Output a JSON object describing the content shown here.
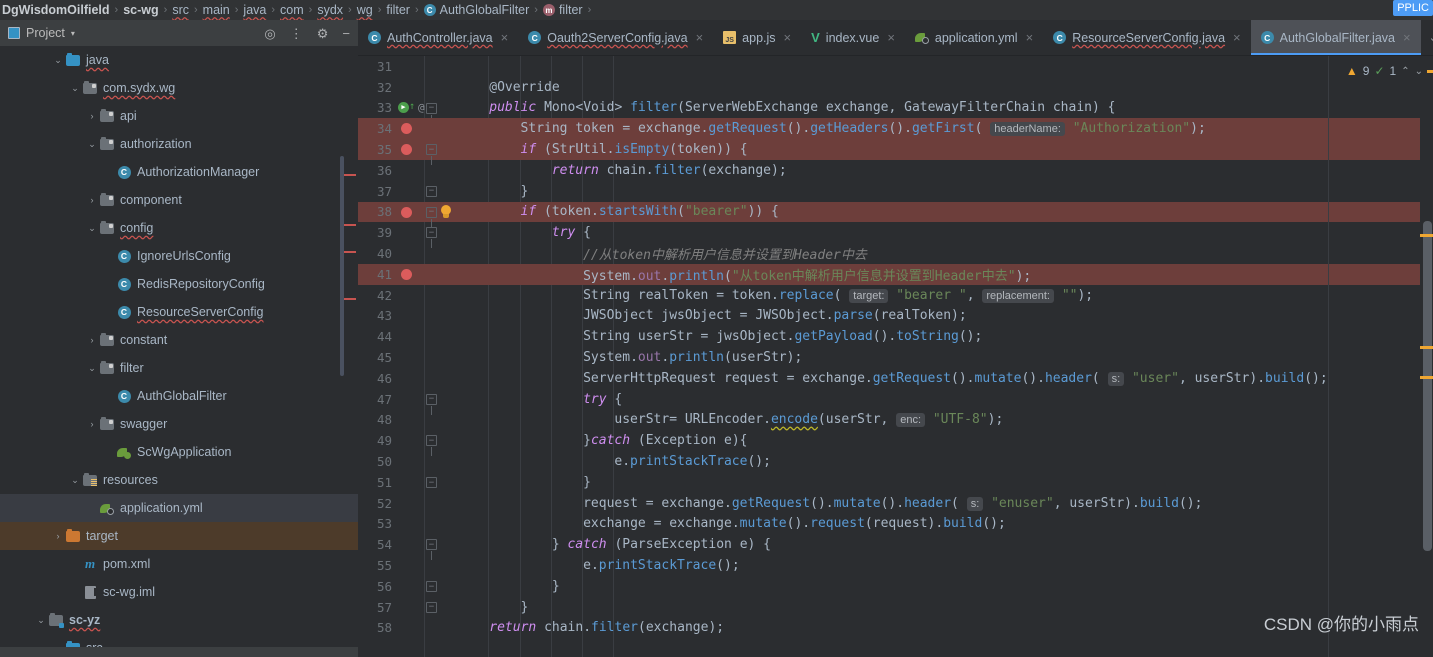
{
  "breadcrumb": {
    "items": [
      {
        "label": "DgWisdomOilfield",
        "style": "bold",
        "icon": ""
      },
      {
        "label": "sc-wg",
        "style": "bold",
        "icon": ""
      },
      {
        "label": "src",
        "style": "wavy",
        "icon": ""
      },
      {
        "label": "main",
        "style": "wavy",
        "icon": ""
      },
      {
        "label": "java",
        "style": "wavy",
        "icon": ""
      },
      {
        "label": "com",
        "style": "wavy",
        "icon": ""
      },
      {
        "label": "sydx",
        "style": "wavy",
        "icon": ""
      },
      {
        "label": "wg",
        "style": "wavy",
        "icon": ""
      },
      {
        "label": "filter",
        "style": "plain",
        "icon": ""
      },
      {
        "label": "AuthGlobalFilter",
        "style": "plain",
        "icon": "class-icon"
      },
      {
        "label": "filter",
        "style": "plain",
        "icon": "method-icon"
      }
    ],
    "separator": "›",
    "top_right_chip": "PPLIC"
  },
  "project_panel": {
    "title": "Project",
    "dropdown_caret": "▾",
    "toolbar_icons": [
      "locate-icon",
      "collapse-all-icon",
      "settings-gear-icon",
      "hide-icon"
    ],
    "tree": [
      {
        "label": "java",
        "indent": 3,
        "arrow": "⌄",
        "icon": "folder-blue",
        "style": "wavy"
      },
      {
        "label": "com.sydx.wg",
        "indent": 4,
        "arrow": "⌄",
        "icon": "folder-package",
        "style": "wavy"
      },
      {
        "label": "api",
        "indent": 5,
        "arrow": "›",
        "icon": "folder-package",
        "style": "plain"
      },
      {
        "label": "authorization",
        "indent": 5,
        "arrow": "⌄",
        "icon": "folder-package",
        "style": "plain"
      },
      {
        "label": "AuthorizationManager",
        "indent": 6,
        "arrow": "",
        "icon": "class-icon",
        "style": "plain"
      },
      {
        "label": "component",
        "indent": 5,
        "arrow": "›",
        "icon": "folder-package",
        "style": "plain"
      },
      {
        "label": "config",
        "indent": 5,
        "arrow": "⌄",
        "icon": "folder-package",
        "style": "wavy"
      },
      {
        "label": "IgnoreUrlsConfig",
        "indent": 6,
        "arrow": "",
        "icon": "class-icon",
        "style": "plain"
      },
      {
        "label": "RedisRepositoryConfig",
        "indent": 6,
        "arrow": "",
        "icon": "class-icon",
        "style": "plain"
      },
      {
        "label": "ResourceServerConfig",
        "indent": 6,
        "arrow": "",
        "icon": "class-icon",
        "style": "wavy"
      },
      {
        "label": "constant",
        "indent": 5,
        "arrow": "›",
        "icon": "folder-package",
        "style": "plain"
      },
      {
        "label": "filter",
        "indent": 5,
        "arrow": "⌄",
        "icon": "folder-package",
        "style": "plain"
      },
      {
        "label": "AuthGlobalFilter",
        "indent": 6,
        "arrow": "",
        "icon": "class-icon",
        "style": "plain"
      },
      {
        "label": "swagger",
        "indent": 5,
        "arrow": "›",
        "icon": "folder-package",
        "style": "plain"
      },
      {
        "label": "ScWgApplication",
        "indent": 6,
        "arrow": "",
        "icon": "spring-run-icon",
        "style": "plain"
      },
      {
        "label": "resources",
        "indent": 4,
        "arrow": "⌄",
        "icon": "folder-resources",
        "style": "plain"
      },
      {
        "label": "application.yml",
        "indent": 5,
        "arrow": "",
        "icon": "yaml-icon",
        "style": "plain",
        "row": "selected"
      },
      {
        "label": "target",
        "indent": 3,
        "arrow": "›",
        "icon": "folder-orange",
        "style": "plain",
        "row": "excluded"
      },
      {
        "label": "pom.xml",
        "indent": 4,
        "arrow": "",
        "icon": "maven-icon",
        "style": "plain"
      },
      {
        "label": "sc-wg.iml",
        "indent": 4,
        "arrow": "",
        "icon": "iml-icon",
        "style": "plain"
      },
      {
        "label": "sc-yz",
        "indent": 2,
        "arrow": "⌄",
        "icon": "folder-module",
        "style": "wavy bold"
      },
      {
        "label": "src",
        "indent": 3,
        "arrow": "⌄",
        "icon": "folder-blue",
        "style": "plain"
      }
    ]
  },
  "editor_tabs": [
    {
      "label": "AuthController.java",
      "icon": "class-icon",
      "active": false,
      "wavy": true
    },
    {
      "label": "Oauth2ServerConfig.java",
      "icon": "class-icon",
      "active": false,
      "wavy": true
    },
    {
      "label": "app.js",
      "icon": "js-icon",
      "active": false,
      "wavy": false
    },
    {
      "label": "index.vue",
      "icon": "vue-icon",
      "active": false,
      "wavy": false
    },
    {
      "label": "application.yml",
      "icon": "yaml-icon",
      "active": false,
      "wavy": false
    },
    {
      "label": "ResourceServerConfig.java",
      "icon": "class-icon",
      "active": false,
      "wavy": true
    },
    {
      "label": "AuthGlobalFilter.java",
      "icon": "class-icon",
      "active": true,
      "wavy": false
    }
  ],
  "tab_close_glyph": "×",
  "tabs_overflow_caret": "⌄",
  "inspection_widget": {
    "warning_icon": "warning-triangle-icon",
    "warning_count": "9",
    "check_icon": "inspection-check-icon",
    "check_count": "1",
    "prev_glyph": "⌃",
    "next_glyph": "⌄"
  },
  "code": {
    "first_line_number": 31,
    "lines": [
      {
        "n": 31,
        "hl": false,
        "gutter": {}
      },
      {
        "n": 32,
        "hl": false,
        "gutter": {}
      },
      {
        "n": 33,
        "hl": false,
        "gutter": {
          "run": true,
          "up": true,
          "at": true,
          "fold": "open"
        }
      },
      {
        "n": 34,
        "hl": true,
        "gutter": {
          "bp": true
        }
      },
      {
        "n": 35,
        "hl": true,
        "gutter": {
          "bp": true,
          "fold": "open"
        }
      },
      {
        "n": 36,
        "hl": false,
        "gutter": {}
      },
      {
        "n": 37,
        "hl": false,
        "gutter": {
          "fold": "close"
        }
      },
      {
        "n": 38,
        "hl": true,
        "gutter": {
          "bp": true,
          "fold": "open",
          "bulb": true
        }
      },
      {
        "n": 39,
        "hl": false,
        "gutter": {
          "fold": "open"
        }
      },
      {
        "n": 40,
        "hl": false,
        "gutter": {}
      },
      {
        "n": 41,
        "hl": true,
        "gutter": {
          "bp": true
        }
      },
      {
        "n": 42,
        "hl": false,
        "gutter": {}
      },
      {
        "n": 43,
        "hl": false,
        "gutter": {}
      },
      {
        "n": 44,
        "hl": false,
        "gutter": {}
      },
      {
        "n": 45,
        "hl": false,
        "gutter": {}
      },
      {
        "n": 46,
        "hl": false,
        "gutter": {}
      },
      {
        "n": 47,
        "hl": false,
        "gutter": {
          "fold": "open"
        }
      },
      {
        "n": 48,
        "hl": false,
        "gutter": {}
      },
      {
        "n": 49,
        "hl": false,
        "gutter": {
          "fold": "open"
        }
      },
      {
        "n": 50,
        "hl": false,
        "gutter": {}
      },
      {
        "n": 51,
        "hl": false,
        "gutter": {
          "fold": "close"
        }
      },
      {
        "n": 52,
        "hl": false,
        "gutter": {}
      },
      {
        "n": 53,
        "hl": false,
        "gutter": {}
      },
      {
        "n": 54,
        "hl": false,
        "gutter": {
          "fold": "open"
        }
      },
      {
        "n": 55,
        "hl": false,
        "gutter": {}
      },
      {
        "n": 56,
        "hl": false,
        "gutter": {
          "fold": "close"
        }
      },
      {
        "n": 57,
        "hl": false,
        "gutter": {
          "fold": "close"
        }
      },
      {
        "n": 58,
        "hl": false,
        "gutter": {}
      }
    ],
    "text": {
      "l31": "",
      "l32": "@Override",
      "l33": "public Mono<Void> filter(ServerWebExchange exchange, GatewayFilterChain chain) {",
      "l34": "String token = exchange.getRequest().getHeaders().getFirst( headerName: \"Authorization\");",
      "l35": "if (StrUtil.isEmpty(token)) {",
      "l36": "return chain.filter(exchange);",
      "l37": "}",
      "l38": "if (token.startsWith(\"bearer\")) {",
      "l39": "try {",
      "l40": "//从token中解析用户信息并设置到Header中去",
      "l41": "System.out.println(\"从token中解析用户信息并设置到Header中去\");",
      "l42": "String realToken = token.replace( target: \"bearer \", replacement: \"\");",
      "l43": "JWSObject jwsObject = JWSObject.parse(realToken);",
      "l44": "String userStr = jwsObject.getPayload().toString();",
      "l45": "System.out.println(userStr);",
      "l46": "ServerHttpRequest request = exchange.getRequest().mutate().header( s: \"user\", userStr).build();",
      "l47": "try {",
      "l48": "userStr= URLEncoder.encode(userStr, enc: \"UTF-8\");",
      "l49": "}catch (Exception e){",
      "l50": "e.printStackTrace();",
      "l51": "}",
      "l52": "request = exchange.getRequest().mutate().header( s: \"enuser\", userStr).build();",
      "l53": "exchange = exchange.mutate().request(request).build();",
      "l54": "} catch (ParseException e) {",
      "l55": "e.printStackTrace();",
      "l56": "}",
      "l57": "}",
      "l58": "return chain.filter(exchange);"
    }
  },
  "watermark": "CSDN @你的小雨点"
}
